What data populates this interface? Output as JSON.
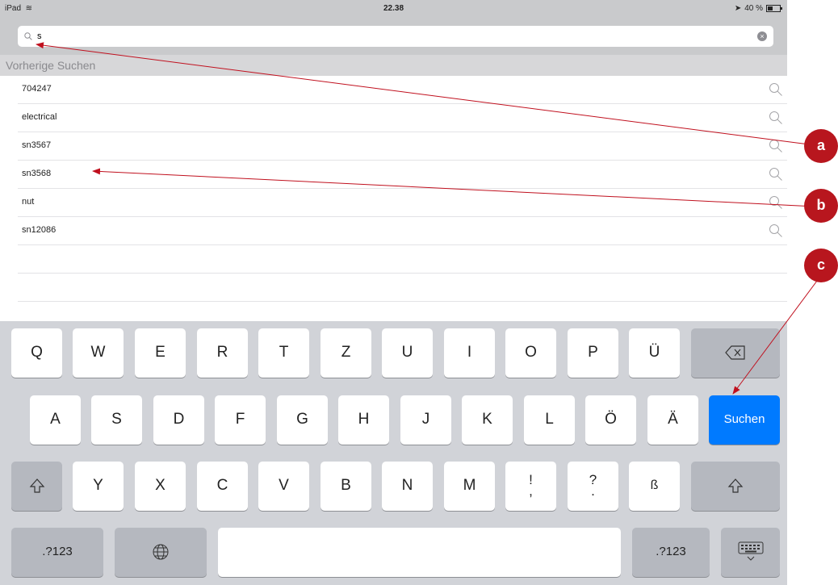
{
  "status_bar": {
    "device": "iPad",
    "time": "22.38",
    "battery_text": "40 %",
    "battery_level": 0.4
  },
  "search": {
    "value": "s",
    "placeholder": ""
  },
  "section_header": "Vorherige Suchen",
  "recent_searches": [
    "704247",
    "electrical",
    "sn3567",
    "sn3568",
    "nut",
    "sn12086"
  ],
  "keyboard": {
    "row1": [
      "Q",
      "W",
      "E",
      "R",
      "T",
      "Z",
      "U",
      "I",
      "O",
      "P",
      "Ü"
    ],
    "row2": [
      "A",
      "S",
      "D",
      "F",
      "G",
      "H",
      "J",
      "K",
      "L",
      "Ö",
      "Ä"
    ],
    "row3": [
      "Y",
      "X",
      "C",
      "V",
      "B",
      "N",
      "M"
    ],
    "row3_punct1": [
      "!",
      ","
    ],
    "row3_punct2": [
      "?",
      "."
    ],
    "row3_last": "ß",
    "search_key": "Suchen",
    "numbers_key": ".?123"
  },
  "callouts": [
    "a",
    "b",
    "c"
  ],
  "colors": {
    "accent": "#007aff",
    "callout": "#b8161e",
    "arrow": "#c0101e"
  },
  "icons": [
    "wifi-icon",
    "location-icon",
    "battery-icon",
    "search-icon",
    "clear-icon",
    "backspace-icon",
    "shift-icon",
    "globe-icon",
    "keyboard-dismiss-icon"
  ]
}
